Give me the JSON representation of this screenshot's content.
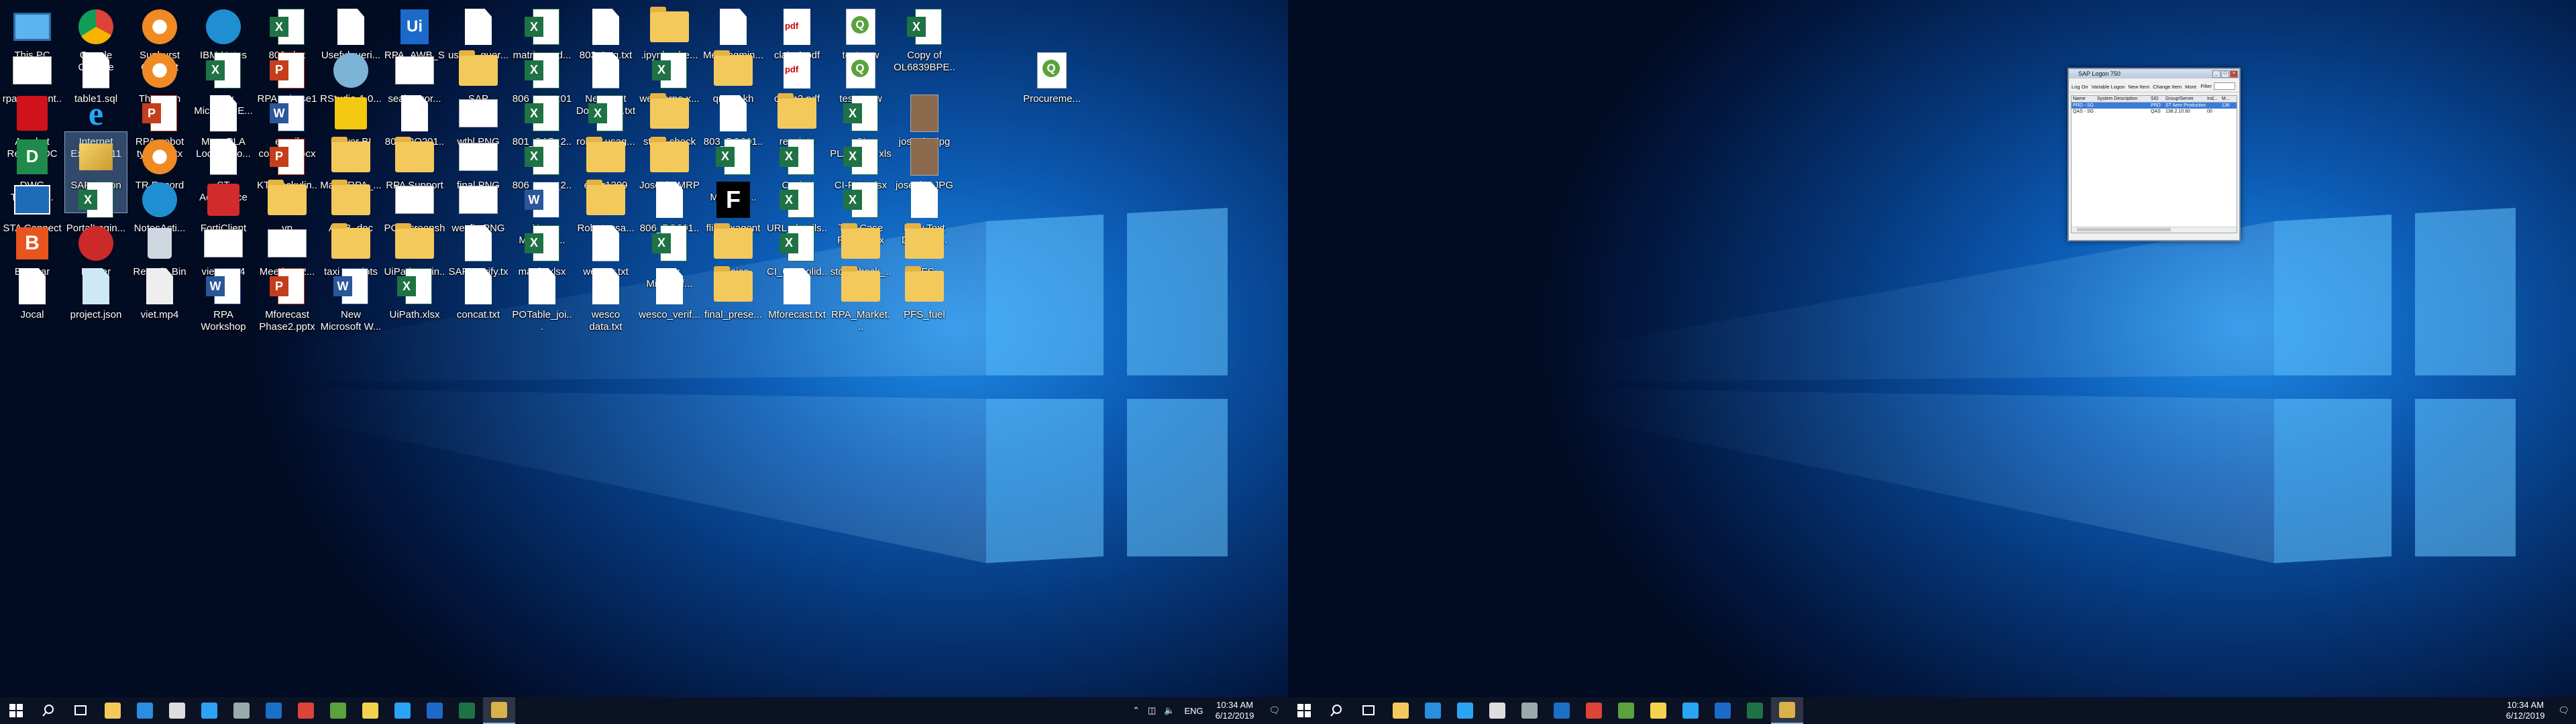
{
  "monitor1": {
    "icons": [
      {
        "label": "This PC",
        "type": "pc",
        "col": 0,
        "row": 0
      },
      {
        "label": "Google Chrome",
        "type": "chrome",
        "col": 1,
        "row": 0
      },
      {
        "label": "Sunburst Connect",
        "type": "sun",
        "col": 2,
        "row": 0
      },
      {
        "label": "IBM Notes",
        "type": "ibm",
        "col": 3,
        "row": 0
      },
      {
        "label": "803.xlsx",
        "type": "xl",
        "col": 4,
        "row": 0
      },
      {
        "label": "Usefulqueri...",
        "type": "doc",
        "col": 5,
        "row": 0
      },
      {
        "label": "RPA_AWB_S... 07-30-19).x...",
        "type": "ui",
        "col": 6,
        "row": 0
      },
      {
        "label": "useful_quer...",
        "type": "doc",
        "col": 7,
        "row": 0
      },
      {
        "label": "matrix_upd...",
        "type": "xl",
        "col": 8,
        "row": 0
      },
      {
        "label": "803_Log.txt",
        "type": "doc",
        "col": 9,
        "row": 0
      },
      {
        "label": ".ipynb_che...",
        "type": "folder",
        "col": 10,
        "row": 0
      },
      {
        "label": "Meetingmin...",
        "type": "doc",
        "col": 11,
        "row": 0
      },
      {
        "label": "claim1.pdf",
        "type": "pdf",
        "col": 12,
        "row": 0
      },
      {
        "label": "test.qvw",
        "type": "qvw",
        "col": 13,
        "row": 0
      },
      {
        "label": "Copy of OL6839BPE...",
        "type": "xl",
        "col": 14,
        "row": 0
      },
      {
        "label": "rpa_present...",
        "type": "img",
        "col": 0,
        "row": 1
      },
      {
        "label": "table1.sql",
        "type": "doc",
        "col": 1,
        "row": 1
      },
      {
        "label": "Thomson Reuters",
        "type": "sun",
        "col": 2,
        "row": 1
      },
      {
        "label": "New Microsoft E...",
        "type": "xl",
        "col": 3,
        "row": 1
      },
      {
        "label": "RPA_Phase1... and challen...",
        "type": "pp",
        "col": 4,
        "row": 1
      },
      {
        "label": "RStudio-1.0...",
        "type": "globe",
        "col": 5,
        "row": 1
      },
      {
        "label": "seal_error...",
        "type": "img",
        "col": 6,
        "row": 1
      },
      {
        "label": "SAP",
        "type": "folder",
        "col": 7,
        "row": 1
      },
      {
        "label": "806_SAP201...",
        "type": "xl",
        "col": 8,
        "row": 1
      },
      {
        "label": "New Text Document.txt",
        "type": "doc",
        "col": 9,
        "row": 1
      },
      {
        "label": "wencorpo.x...",
        "type": "xl",
        "col": 10,
        "row": 1
      },
      {
        "label": "qns to kh",
        "type": "folder",
        "col": 11,
        "row": 1
      },
      {
        "label": "claim2.pdf",
        "type": "pdf",
        "col": 12,
        "row": 1
      },
      {
        "label": "test2.qvw",
        "type": "qvw",
        "col": 13,
        "row": 1
      },
      {
        "label": "Procureme...",
        "type": "qvw",
        "col": 16,
        "row": 1
      },
      {
        "label": "Acrobat Reader DC",
        "type": "acro",
        "col": 0,
        "row": 2
      },
      {
        "label": "Internet Explorer 11",
        "type": "ie",
        "col": 1,
        "row": 2
      },
      {
        "label": "RPA_robot types.pptx",
        "type": "pp",
        "col": 2,
        "row": 2
      },
      {
        "label": "Map_PLA Location o...",
        "type": "doc",
        "col": 3,
        "row": 2
      },
      {
        "label": "email content.docx",
        "type": "wd",
        "col": 4,
        "row": 2
      },
      {
        "label": "Power BI Desktop",
        "type": "pbi",
        "col": 5,
        "row": 2
      },
      {
        "label": "803_PO201...",
        "type": "doc",
        "col": 6,
        "row": 2
      },
      {
        "label": "wtbl.PNG",
        "type": "img",
        "col": 7,
        "row": 2
      },
      {
        "label": "801_SAP_2...",
        "type": "xl",
        "col": 8,
        "row": 2
      },
      {
        "label": "robot_usag...",
        "type": "xl",
        "col": 9,
        "row": 2
      },
      {
        "label": "stock check robot",
        "type": "folder",
        "col": 10,
        "row": 2
      },
      {
        "label": "803_PO201...",
        "type": "doc",
        "col": 11,
        "row": 2
      },
      {
        "label": "receipts",
        "type": "folder",
        "col": 12,
        "row": 2
      },
      {
        "label": "CI PLA_0811.xlsx",
        "type": "xl",
        "col": 13,
        "row": 2
      },
      {
        "label": "joseph2.jpg",
        "type": "photo",
        "col": 14,
        "row": 2
      },
      {
        "label": "DWG TrueVie...",
        "type": "dwg",
        "col": 0,
        "row": 3
      },
      {
        "label": "SAP Logon",
        "type": "sap",
        "col": 1,
        "row": 3,
        "selected": true
      },
      {
        "label": "TR Record Keeper",
        "type": "sun",
        "col": 2,
        "row": 3
      },
      {
        "label": "ST Aerospace Paya Lebar ...",
        "type": "doc",
        "col": 3,
        "row": 3
      },
      {
        "label": "KT_Jackulin...",
        "type": "pp",
        "col": 4,
        "row": 3
      },
      {
        "label": "Main_RPA_...",
        "type": "folder",
        "col": 5,
        "row": 3
      },
      {
        "label": "RPA Support",
        "type": "folder",
        "col": 6,
        "row": 3
      },
      {
        "label": "final.PNG",
        "type": "img",
        "col": 7,
        "row": 3
      },
      {
        "label": "806_SAP_2...",
        "type": "xl",
        "col": 8,
        "row": 3
      },
      {
        "label": "error1209",
        "type": "folder",
        "col": 9,
        "row": 3
      },
      {
        "label": "Joseph_MRP",
        "type": "folder",
        "col": 10,
        "row": 3
      },
      {
        "label": "New Microsof...",
        "type": "xl",
        "col": 11,
        "row": 3
      },
      {
        "label": "CI.xlsx",
        "type": "xl",
        "col": 12,
        "row": 3
      },
      {
        "label": "CI-PLA.xlsx",
        "type": "xl",
        "col": 13,
        "row": 3
      },
      {
        "label": "joseph1.JPG",
        "type": "photo",
        "col": 14,
        "row": 3
      },
      {
        "label": "STA Connect",
        "type": "sta",
        "col": 0,
        "row": 4
      },
      {
        "label": "PortalLogin...",
        "type": "xl",
        "col": 1,
        "row": 4
      },
      {
        "label": "NotesActi...",
        "type": "ibm",
        "col": 2,
        "row": 4
      },
      {
        "label": "FortiClient",
        "type": "forti",
        "col": 3,
        "row": 4
      },
      {
        "label": "vp",
        "type": "folder",
        "col": 4,
        "row": 4
      },
      {
        "label": "AWB_doc",
        "type": "folder",
        "col": 5,
        "row": 4
      },
      {
        "label": "PO_screensh...",
        "type": "img",
        "col": 6,
        "row": 4
      },
      {
        "label": "wesfin.PNG",
        "type": "img",
        "col": 7,
        "row": 4
      },
      {
        "label": "New Microsof...",
        "type": "wd",
        "col": 8,
        "row": 4
      },
      {
        "label": "Robot_usa...",
        "type": "folder",
        "col": 9,
        "row": 4
      },
      {
        "label": "806_PO201...",
        "type": "doc",
        "col": 10,
        "row": 4
      },
      {
        "label": "flipboxagent (1).exe",
        "type": "flip",
        "col": 11,
        "row": 4
      },
      {
        "label": "URL_details...",
        "type": "xl",
        "col": 12,
        "row": 4
      },
      {
        "label": "Test Case Robot.xlsx",
        "type": "xl",
        "col": 13,
        "row": 4
      },
      {
        "label": "New Text Docume...",
        "type": "doc",
        "col": 14,
        "row": 4
      },
      {
        "label": "Bomgar",
        "type": "bomgar",
        "col": 0,
        "row": 5
      },
      {
        "label": "Eraser",
        "type": "eraser",
        "col": 1,
        "row": 5
      },
      {
        "label": "Recycle Bin",
        "type": "bin",
        "col": 2,
        "row": 5
      },
      {
        "label": "viet2.mp4",
        "type": "img",
        "col": 3,
        "row": 5
      },
      {
        "label": "Meeting_2...",
        "type": "img",
        "col": 4,
        "row": 5
      },
      {
        "label": "taxi receipts",
        "type": "folder",
        "col": 5,
        "row": 5
      },
      {
        "label": "UiPath_train...",
        "type": "folder",
        "col": 6,
        "row": 5
      },
      {
        "label": "SAP_verify.txt",
        "type": "doc",
        "col": 7,
        "row": 5
      },
      {
        "label": "matrix.xlsx",
        "type": "xl",
        "col": 8,
        "row": 5
      },
      {
        "label": "wencor.txt",
        "type": "doc",
        "col": 9,
        "row": 5
      },
      {
        "label": "New Microsof...",
        "type": "xl",
        "col": 10,
        "row": 5
      },
      {
        "label": "invoice",
        "type": "folder",
        "col": 11,
        "row": 5
      },
      {
        "label": "CI_Consolid...",
        "type": "xl",
        "col": 12,
        "row": 5
      },
      {
        "label": "stockcheck_...",
        "type": "folder",
        "col": 13,
        "row": 5
      },
      {
        "label": "PFS",
        "type": "folder",
        "col": 14,
        "row": 5
      },
      {
        "label": "Jocal",
        "type": "doc",
        "col": 0,
        "row": 6
      },
      {
        "label": "project.json",
        "type": "json",
        "col": 1,
        "row": 6
      },
      {
        "label": "viet.mp4",
        "type": "video",
        "col": 2,
        "row": 6
      },
      {
        "label": "RPA Workshop S...",
        "type": "wd",
        "col": 3,
        "row": 6
      },
      {
        "label": "Mforecast Phase2.pptx",
        "type": "pp",
        "col": 4,
        "row": 6
      },
      {
        "label": "New Microsoft W...",
        "type": "wd",
        "col": 5,
        "row": 6
      },
      {
        "label": "UiPath.xlsx",
        "type": "xl",
        "col": 6,
        "row": 6
      },
      {
        "label": "concat.txt",
        "type": "doc",
        "col": 7,
        "row": 6
      },
      {
        "label": "POTable_joi...",
        "type": "doc",
        "col": 8,
        "row": 6
      },
      {
        "label": "wesco data.txt",
        "type": "doc",
        "col": 9,
        "row": 6
      },
      {
        "label": "wesco_verif...",
        "type": "doc",
        "col": 10,
        "row": 6
      },
      {
        "label": "final_prese...",
        "type": "folder",
        "col": 11,
        "row": 6
      },
      {
        "label": "Mforecast.txt",
        "type": "doc",
        "col": 12,
        "row": 6
      },
      {
        "label": "RPA_Market...",
        "type": "folder",
        "col": 13,
        "row": 6
      },
      {
        "label": "PFS_fuel",
        "type": "folder",
        "col": 14,
        "row": 6
      }
    ],
    "taskbar": {
      "apps": [
        "file-explorer",
        "edge",
        "store",
        "ie",
        "tools",
        "outlook",
        "chrome",
        "qlikview",
        "notes",
        "ie-2",
        "uipath",
        "excel",
        "sap-logon"
      ],
      "lang": "ENG",
      "time": "10:34 AM",
      "date": "6/12/2019"
    }
  },
  "sap_window": {
    "title": "SAP Logon 750",
    "toolbar": [
      "Log On",
      "Variable Logon",
      "New Item",
      "Change Item",
      "More"
    ],
    "filter_label": "Filter",
    "columns": [
      "Name",
      "System Description",
      "SID",
      "Group/Server",
      "Ind...",
      "M..."
    ],
    "rows": [
      {
        "name": "PRD - SG ...",
        "desc": "",
        "sid": "PRD",
        "server": "ST Aero Production",
        "ind": "",
        "m": "136"
      },
      {
        "name": "QAS - SG ...",
        "desc": "",
        "sid": "QAS",
        "server": "138.2.10.60",
        "ind": "00",
        "m": ""
      }
    ]
  },
  "monitor2": {
    "taskbar": {
      "apps": [
        "file-explorer",
        "edge",
        "ie",
        "store",
        "tools",
        "outlook",
        "chrome",
        "qlikview",
        "notes",
        "ie-2",
        "uipath",
        "excel",
        "sap-logon"
      ],
      "time": "10:34 AM",
      "date": "6/12/2019"
    }
  }
}
